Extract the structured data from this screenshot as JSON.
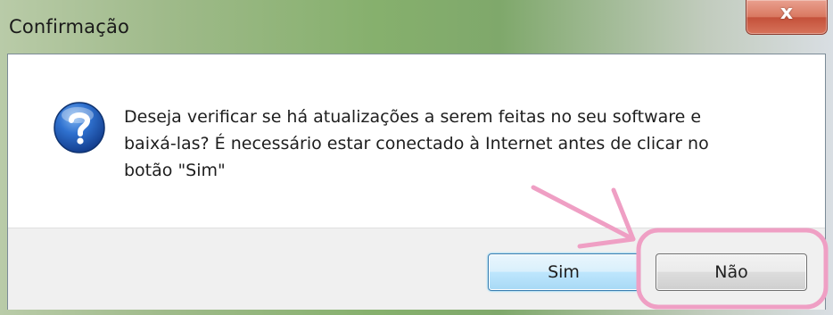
{
  "window": {
    "title": "Confirmação",
    "close_label": "x"
  },
  "dialog": {
    "icon": "question-icon",
    "message_lines": [
      "Deseja verificar se há atualizações a serem feitas no seu software e",
      "baixá-las? É necessário estar conectado à Internet antes de clicar no",
      "botão \"Sim\""
    ]
  },
  "buttons": {
    "yes_label": "Sim",
    "no_label": "Não"
  },
  "colors": {
    "annotation": "#ef9fc4",
    "icon_blue": "#1f5fbf",
    "default_button_border": "#3c7fb1"
  }
}
